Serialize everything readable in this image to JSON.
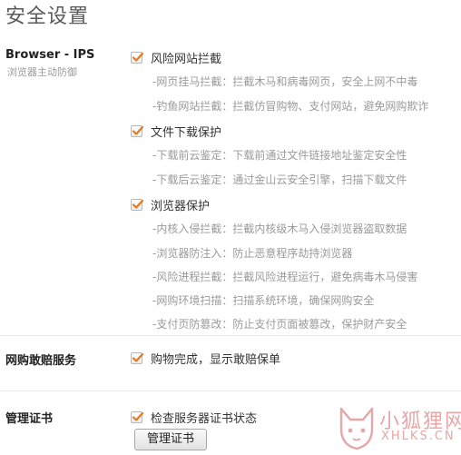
{
  "page_title": "安全设置",
  "sections": {
    "browser_ips": {
      "title": "Browser - IPS",
      "subtitle": "浏览器主动防御",
      "groups": [
        {
          "label": "风险网站拦截",
          "checked": true,
          "details": [
            "-网页挂马拦截：拦截木马和病毒网页，安全上网不中毒",
            "-钓鱼网站拦截：拦截仿冒购物、支付网站，避免网购欺诈"
          ]
        },
        {
          "label": "文件下载保护",
          "checked": true,
          "details": [
            "-下载前云鉴定：下载前通过文件链接地址鉴定安全性",
            "-下载后云鉴定：通过金山云安全引擎，扫描下载文件"
          ]
        },
        {
          "label": "浏览器保护",
          "checked": true,
          "details": [
            "-内核入侵拦截：拦截内核级木马入侵浏览器盗取数据",
            "-浏览器防注入：防止恶意程序劫持浏览器",
            "-风险进程拦截：拦截风险进程运行，避免病毒木马侵害",
            "-网购环境扫描：扫描系统环境，确保网购安全",
            "-支付页防篡改：防止支付页面被篡改，保护财产安全"
          ]
        }
      ]
    },
    "shopping": {
      "title": "网购敢赔服务",
      "option": {
        "label": "购物完成，显示敢赔保单",
        "checked": true
      }
    },
    "cert": {
      "title": "管理证书",
      "option": {
        "label": "检查服务器证书状态",
        "checked": true
      },
      "button_label": "管理证书"
    }
  },
  "watermark": {
    "cn": "小狐狸网",
    "en": "XHLKS.CN"
  },
  "colors": {
    "checkmark": "#e07a1f",
    "muted_text": "#9a9a9a",
    "watermark": "#e5a7a7"
  }
}
